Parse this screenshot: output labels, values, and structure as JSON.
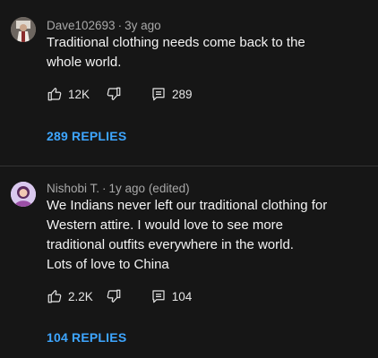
{
  "comments": [
    {
      "author": "Dave102693",
      "age": "3y ago",
      "lines": [
        "Traditional clothing needs come back to the",
        "whole world."
      ],
      "likes": "12K",
      "reply_count": "289",
      "replies_link": "289 REPLIES",
      "avatar_icon": "user-avatar-icon"
    },
    {
      "author": "Nishobi T.",
      "age": "1y ago (edited)",
      "lines": [
        "We Indians never left our traditional clothing for",
        "Western attire. I would love to see more",
        "traditional outfits everywhere in the world.",
        "Lots of love to China"
      ],
      "likes": "2.2K",
      "reply_count": "104",
      "replies_link": "104 REPLIES",
      "avatar_icon": "user-avatar-icon"
    }
  ],
  "separator": "·",
  "colors": {
    "background": "#161616",
    "link": "#3ea6ff",
    "meta": "#a8a8a8"
  }
}
